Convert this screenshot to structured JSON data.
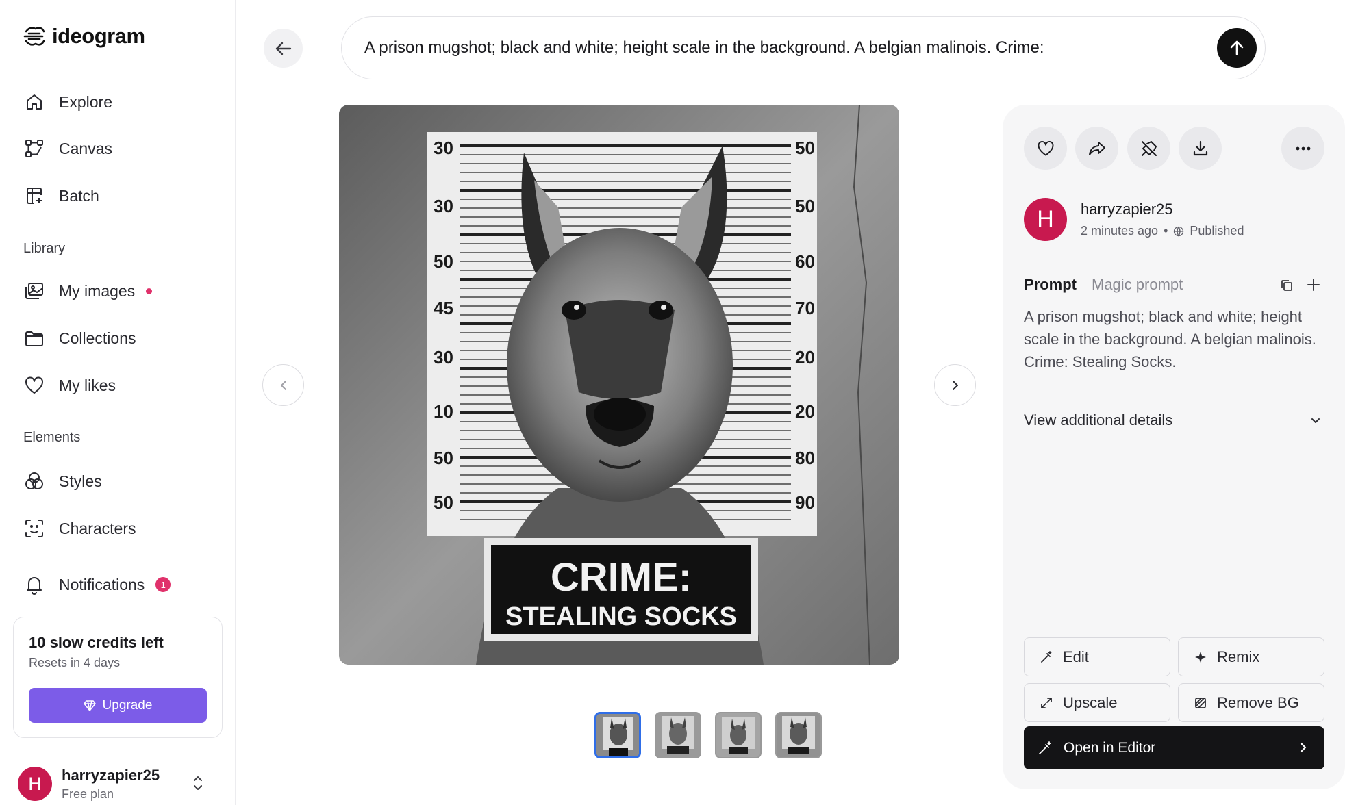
{
  "app": {
    "logo_text": "ideogram"
  },
  "sidebar": {
    "nav": [
      {
        "label": "Explore",
        "icon": "home-icon"
      },
      {
        "label": "Canvas",
        "icon": "canvas-icon"
      },
      {
        "label": "Batch",
        "icon": "batch-icon"
      }
    ],
    "library_label": "Library",
    "library": [
      {
        "label": "My images",
        "icon": "images-icon"
      },
      {
        "label": "Collections",
        "icon": "folder-icon"
      },
      {
        "label": "My likes",
        "icon": "heart-icon"
      }
    ],
    "elements_label": "Elements",
    "elements": [
      {
        "label": "Styles",
        "icon": "styles-icon"
      },
      {
        "label": "Characters",
        "icon": "characters-icon"
      }
    ],
    "notifications": {
      "label": "Notifications",
      "count": "1"
    }
  },
  "credits": {
    "title": "10 slow credits left",
    "subtitle": "Resets in 4 days",
    "upgrade_label": "Upgrade"
  },
  "user": {
    "initial": "H",
    "name": "harryzapier25",
    "plan": "Free plan"
  },
  "prompt_bar": {
    "text": "A prison mugshot; black and white; height scale in the background. A belgian malinois. Crime:"
  },
  "image": {
    "scale_left": [
      "30",
      "30",
      "50",
      "45",
      "30",
      "10",
      "50",
      "50"
    ],
    "scale_right": [
      "50",
      "50",
      "60",
      "70",
      "20",
      "20",
      "80",
      "90"
    ],
    "sign_line1": "CRIME:",
    "sign_line2": "STEALING SOCKS",
    "thumbnails": 4,
    "selected_thumbnail": 1
  },
  "panel": {
    "author": {
      "initial": "H",
      "name": "harryzapier25",
      "time": "2 minutes ago",
      "separator": "•",
      "status": "Published"
    },
    "tabs": {
      "prompt": "Prompt",
      "magic": "Magic prompt"
    },
    "prompt_text": "A prison mugshot; black and white; height scale in the background. A belgian malinois. Crime: Stealing Socks.",
    "details_label": "View additional details",
    "buttons": {
      "edit": "Edit",
      "remix": "Remix",
      "upscale": "Upscale",
      "remove_bg": "Remove BG",
      "open_editor": "Open in Editor"
    }
  },
  "colors": {
    "accent_purple": "#7c5ce8",
    "avatar_red": "#c8194f",
    "notification_pink": "#e0316b",
    "thumb_selected": "#2f6ee8"
  }
}
